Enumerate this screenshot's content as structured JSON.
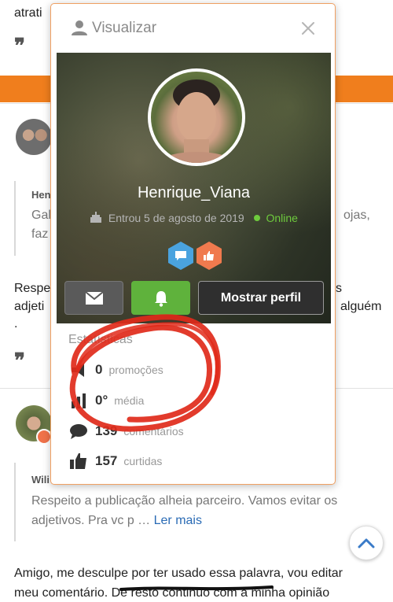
{
  "background": {
    "top_text": "atrati",
    "comment1": {
      "author_short": "Hen",
      "quote_line1": "Gal",
      "quote_line1_end": "ojas,",
      "quote_line2": "faz",
      "body_line1_start": "Respe",
      "body_line1_end": "s",
      "body_line2_start": "adjeti",
      "body_line2_end": "alguém",
      "body_line3": "."
    },
    "comment2": {
      "author_short": "Wili",
      "quote_line1": "Respeito a publicação alheia parceiro. Vamos evitar os",
      "quote_line2": "adjetivos. Pra vc p …",
      "read_more": "Ler mais",
      "body_line1": "Amigo, me desculpe por ter usado essa palavra, vou editar",
      "body_line2": "meu comentário. De resto continuo com a minha opinião"
    }
  },
  "popup": {
    "title": "Visualizar",
    "username": "Henrique_Viana",
    "joined": "Entrou 5 de agosto de 2019",
    "status": "Online",
    "show_profile_label": "Mostrar perfil",
    "stats_title": "Estatísticas",
    "stats": [
      {
        "icon": "megaphone-icon",
        "value": "0",
        "label": "promoções"
      },
      {
        "icon": "bar-chart-icon",
        "value": "0°",
        "label": "média"
      },
      {
        "icon": "comment-icon",
        "value": "139",
        "label": "comentários"
      },
      {
        "icon": "thumbs-up-icon",
        "value": "157",
        "label": "curtidas"
      }
    ]
  },
  "colors": {
    "accent": "#f07e1d",
    "online": "#6ecb3d",
    "bell_button": "#5fb23c",
    "annotation": "#e02a1a"
  }
}
